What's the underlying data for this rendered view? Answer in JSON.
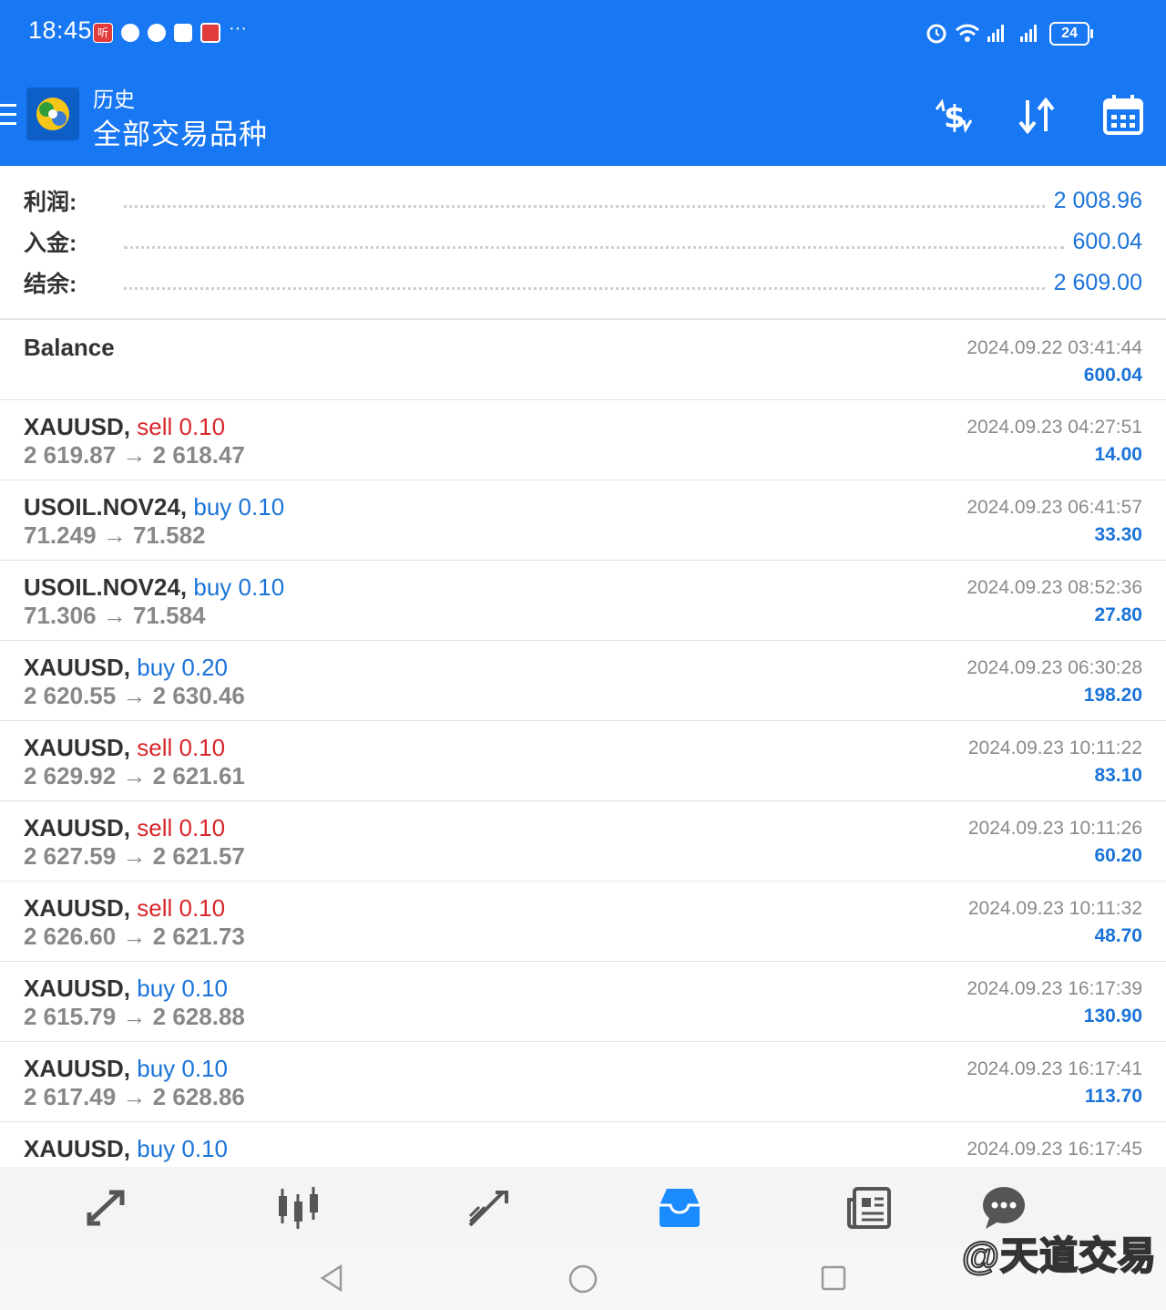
{
  "status_bar": {
    "time": "18:45",
    "notif_badge": "听",
    "battery": "24"
  },
  "app_bar": {
    "subtitle": "历史",
    "title": "全部交易品种"
  },
  "summary": [
    {
      "label": "利润:",
      "value": "2 008.96"
    },
    {
      "label": "入金:",
      "value": "600.04"
    },
    {
      "label": "结余:",
      "value": "2 609.00"
    }
  ],
  "balance_entry": {
    "label": "Balance",
    "time": "2024.09.22 03:41:44",
    "amount": "600.04"
  },
  "deals": [
    {
      "symbol": "XAUUSD,",
      "side": "sell",
      "volume": "0.10",
      "prices": "2 619.87 → 2 618.47",
      "time": "2024.09.23 04:27:51",
      "profit": "14.00"
    },
    {
      "symbol": "USOIL.NOV24,",
      "side": "buy",
      "volume": "0.10",
      "prices": "71.249 → 71.582",
      "time": "2024.09.23 06:41:57",
      "profit": "33.30"
    },
    {
      "symbol": "USOIL.NOV24,",
      "side": "buy",
      "volume": "0.10",
      "prices": "71.306 → 71.584",
      "time": "2024.09.23 08:52:36",
      "profit": "27.80"
    },
    {
      "symbol": "XAUUSD,",
      "side": "buy",
      "volume": "0.20",
      "prices": "2 620.55 → 2 630.46",
      "time": "2024.09.23 06:30:28",
      "profit": "198.20"
    },
    {
      "symbol": "XAUUSD,",
      "side": "sell",
      "volume": "0.10",
      "prices": "2 629.92 → 2 621.61",
      "time": "2024.09.23 10:11:22",
      "profit": "83.10"
    },
    {
      "symbol": "XAUUSD,",
      "side": "sell",
      "volume": "0.10",
      "prices": "2 627.59 → 2 621.57",
      "time": "2024.09.23 10:11:26",
      "profit": "60.20"
    },
    {
      "symbol": "XAUUSD,",
      "side": "sell",
      "volume": "0.10",
      "prices": "2 626.60 → 2 621.73",
      "time": "2024.09.23 10:11:32",
      "profit": "48.70"
    },
    {
      "symbol": "XAUUSD,",
      "side": "buy",
      "volume": "0.10",
      "prices": "2 615.79 → 2 628.88",
      "time": "2024.09.23 16:17:39",
      "profit": "130.90"
    },
    {
      "symbol": "XAUUSD,",
      "side": "buy",
      "volume": "0.10",
      "prices": "2 617.49 → 2 628.86",
      "time": "2024.09.23 16:17:41",
      "profit": "113.70"
    },
    {
      "symbol": "XAUUSD,",
      "side": "buy",
      "volume": "0.10",
      "prices": "",
      "time": "2024.09.23 16:17:45",
      "profit": ""
    }
  ],
  "colors": {
    "brand": "#1877f2",
    "sell": "#d9262a",
    "buy": "#1a73d9",
    "active_tab": "#1a8cff"
  },
  "icons": {
    "toolbar": [
      "currency-exchange-icon",
      "sort-icon",
      "calendar-icon"
    ],
    "bottom_nav": [
      "quotes-icon",
      "chart-icon",
      "trade-icon",
      "history-icon",
      "news-icon",
      "chat-icon"
    ]
  },
  "watermark": "@天道交易"
}
